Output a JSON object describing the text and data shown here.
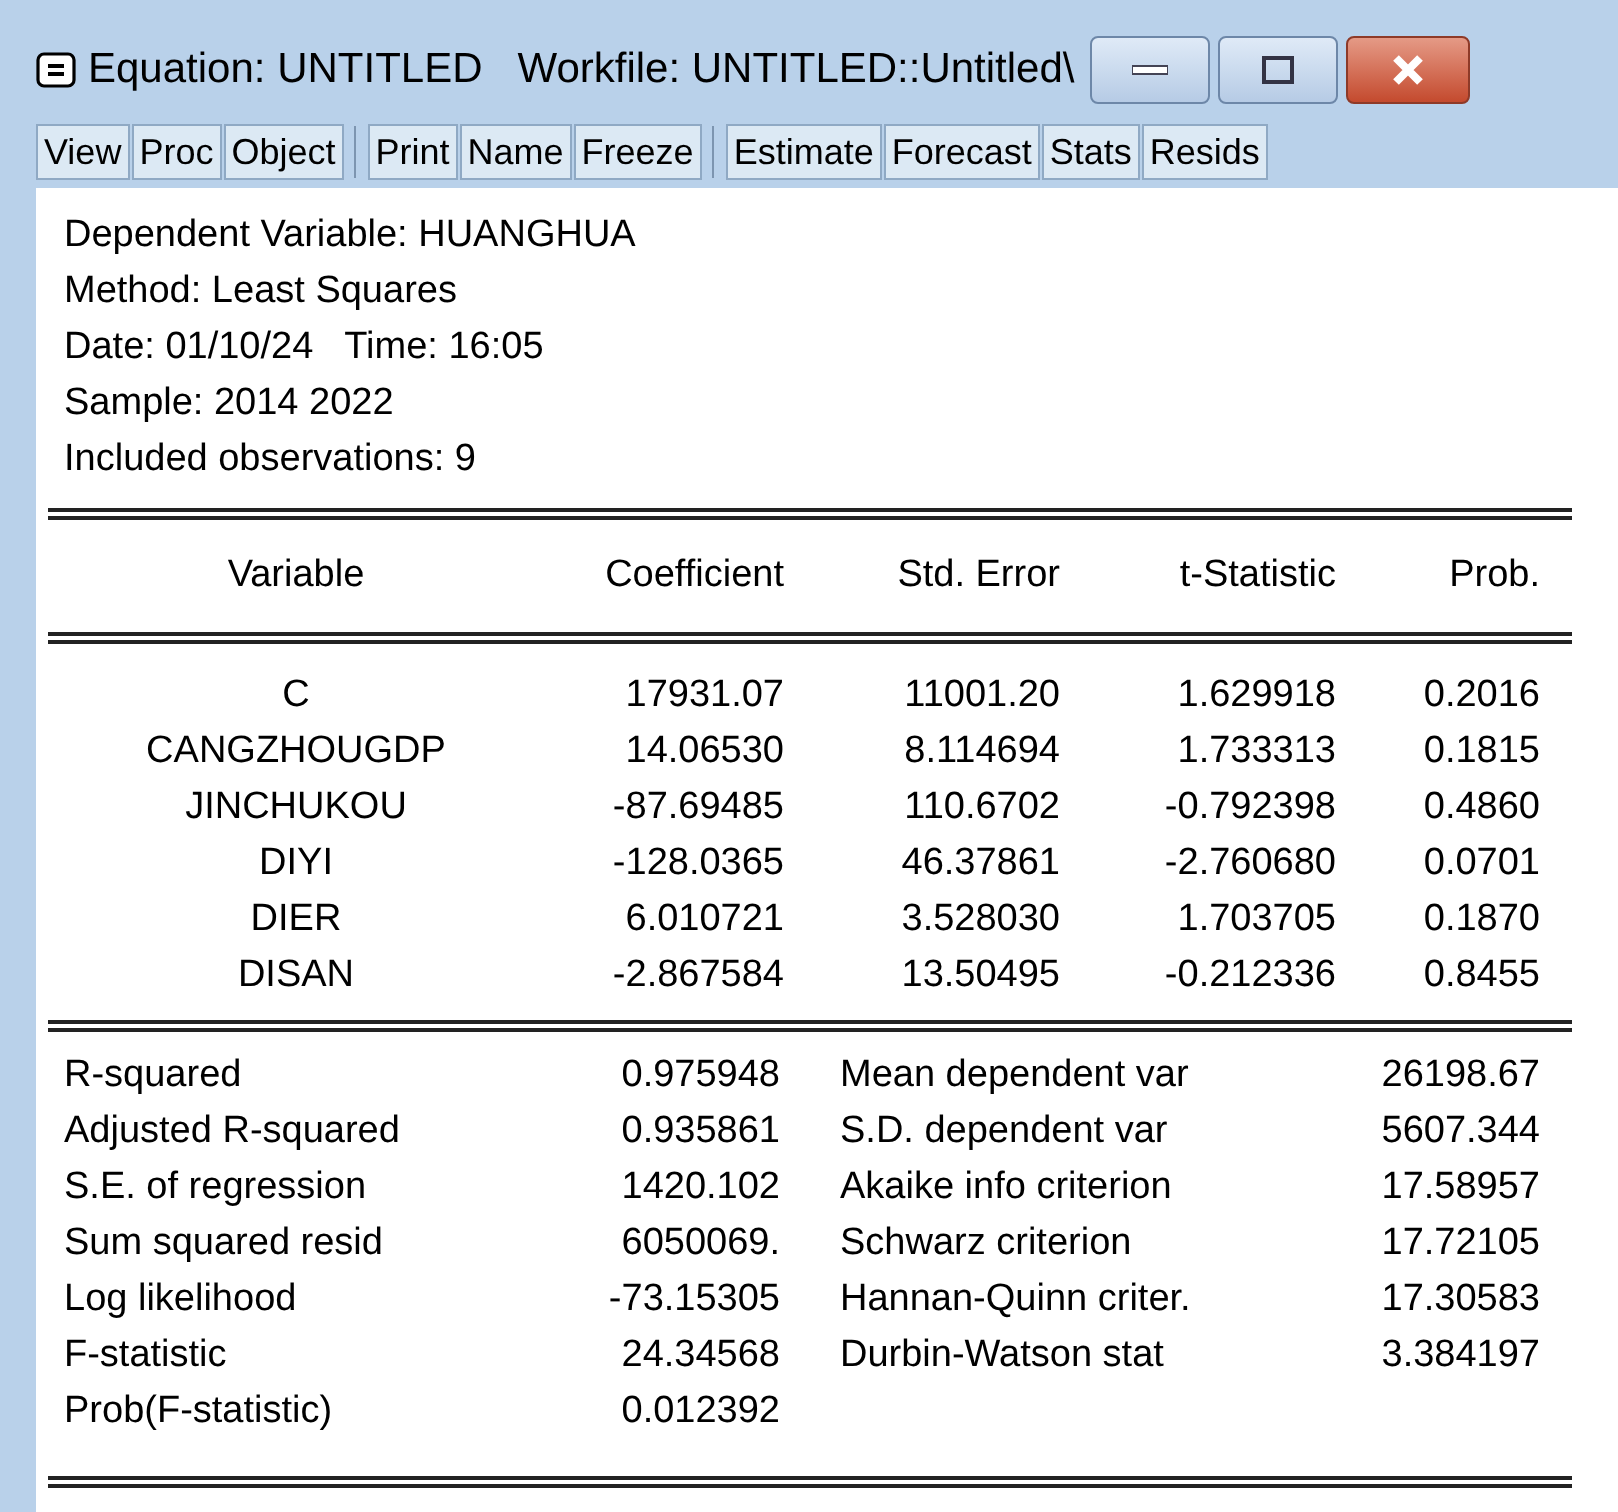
{
  "window": {
    "title": "Equation: UNTITLED   Workfile: UNTITLED::Untitled\\"
  },
  "toolbar": {
    "groups": [
      [
        "View",
        "Proc",
        "Object"
      ],
      [
        "Print",
        "Name",
        "Freeze"
      ],
      [
        "Estimate",
        "Forecast",
        "Stats",
        "Resids"
      ]
    ]
  },
  "header_lines": [
    "Dependent Variable: HUANGHUA",
    "Method: Least Squares",
    "Date: 01/10/24   Time: 16:05",
    "Sample: 2014 2022",
    "Included observations: 9"
  ],
  "table": {
    "columns": [
      "Variable",
      "Coefficient",
      "Std. Error",
      "t-Statistic",
      "Prob."
    ],
    "rows": [
      [
        "C",
        "17931.07",
        "11001.20",
        "1.629918",
        "0.2016"
      ],
      [
        "CANGZHOUGDP",
        "14.06530",
        "8.114694",
        "1.733313",
        "0.1815"
      ],
      [
        "JINCHUKOU",
        "-87.69485",
        "110.6702",
        "-0.792398",
        "0.4860"
      ],
      [
        "DIYI",
        "-128.0365",
        "46.37861",
        "-2.760680",
        "0.0701"
      ],
      [
        "DIER",
        "6.010721",
        "3.528030",
        "1.703705",
        "0.1870"
      ],
      [
        "DISAN",
        "-2.867584",
        "13.50495",
        "-0.212336",
        "0.8455"
      ]
    ]
  },
  "statistics": [
    [
      "R-squared",
      "0.975948",
      "Mean dependent var",
      "26198.67"
    ],
    [
      "Adjusted R-squared",
      "0.935861",
      "S.D. dependent var",
      "5607.344"
    ],
    [
      "S.E. of regression",
      "1420.102",
      "Akaike info criterion",
      "17.58957"
    ],
    [
      "Sum squared resid",
      "6050069.",
      "Schwarz criterion",
      "17.72105"
    ],
    [
      "Log likelihood",
      "-73.15305",
      "Hannan-Quinn criter.",
      "17.30583"
    ],
    [
      "F-statistic",
      "24.34568",
      "Durbin-Watson stat",
      "3.384197"
    ],
    [
      "Prob(F-statistic)",
      "0.012392"
    ]
  ]
}
